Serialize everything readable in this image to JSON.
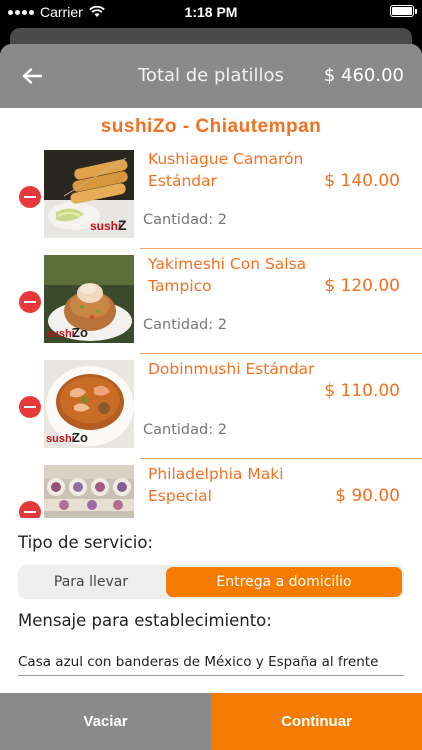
{
  "status_bar": {
    "carrier": "Carrier",
    "time": "1:18 PM"
  },
  "header": {
    "title": "Total de platillos",
    "total": "$ 460.00"
  },
  "store": {
    "name": "sushiZo - Chiautempan"
  },
  "items": [
    {
      "name": "Kushiague Camarón Estándar",
      "price": "$ 140.00",
      "qty": "Cantidad: 2",
      "image": "kushiague-photo"
    },
    {
      "name": "Yakimeshi Con Salsa Tampico",
      "price": "$ 120.00",
      "qty": "Cantidad: 2",
      "image": "yakimeshi-photo"
    },
    {
      "name": "Dobinmushi Estándar",
      "price": "$ 110.00",
      "qty": "Cantidad: 2",
      "image": "dobinmushi-photo"
    },
    {
      "name": "Philadelphia Maki Especial",
      "price": "$ 90.00",
      "qty": "",
      "image": "philadelphia-maki-photo"
    }
  ],
  "service": {
    "label": "Tipo de servicio:",
    "options": [
      "Para llevar",
      "Entrega a domicilio"
    ],
    "selected": "Entrega a domicilio"
  },
  "message": {
    "label": "Mensaje para establecimiento:",
    "value": "Casa azul con banderas de México y España al frente"
  },
  "footer": {
    "clear_label": "Vaciar",
    "continue_label": "Continuar"
  },
  "colors": {
    "accent": "#f57c00",
    "header_gray": "#8a8a8a",
    "remove_red": "#e8393a"
  },
  "thumbnail_lettering": "sushiZo"
}
